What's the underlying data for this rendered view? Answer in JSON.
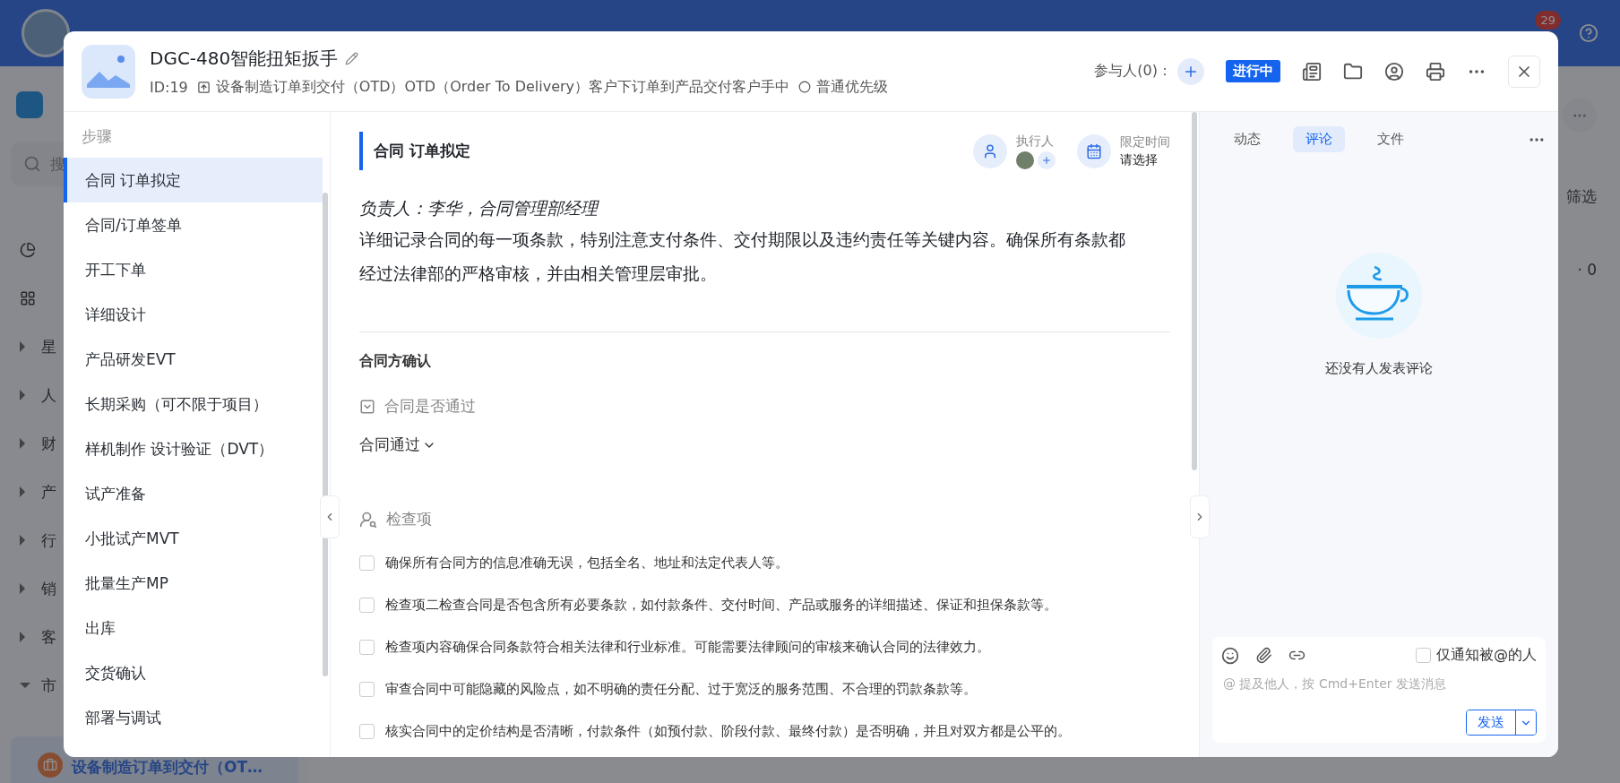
{
  "background": {
    "badge": "29",
    "search_placeholder": "搜",
    "sidebar_items": [
      {
        "label": "星",
        "expanded": false
      },
      {
        "label": "人",
        "expanded": false
      },
      {
        "label": "财",
        "expanded": false
      },
      {
        "label": "产",
        "expanded": false
      },
      {
        "label": "行",
        "expanded": false
      },
      {
        "label": "销",
        "expanded": false
      },
      {
        "label": "客",
        "expanded": false
      },
      {
        "label": "市",
        "expanded": true
      }
    ],
    "selected_item": {
      "label": "设备制造订单到交付（OT…",
      "selected": true
    },
    "filter": "筛选",
    "count": "· 0"
  },
  "modal": {
    "title": "DGC-480智能扭矩扳手",
    "id": "ID:19",
    "process": "设备制造订单到交付（OTD）OTD（Order To Delivery）客户下订单到产品交付客户手中",
    "priority": "普通优先级",
    "participants_label": "参与人(0)：",
    "status": "进行中"
  },
  "steps": {
    "heading": "步骤",
    "items": [
      {
        "label": "合同 订单拟定",
        "selected": true
      },
      {
        "label": "合同/订单签单",
        "selected": false
      },
      {
        "label": "开工下单",
        "selected": false
      },
      {
        "label": "详细设计",
        "selected": false
      },
      {
        "label": "产品研发EVT",
        "selected": false
      },
      {
        "label": "长期采购（可不限于项目）",
        "selected": false
      },
      {
        "label": "样机制作 设计验证（DVT）",
        "selected": false
      },
      {
        "label": "试产准备",
        "selected": false
      },
      {
        "label": "小批试产MVT",
        "selected": false
      },
      {
        "label": "批量生产MP",
        "selected": false
      },
      {
        "label": "出库",
        "selected": false
      },
      {
        "label": "交货确认",
        "selected": false
      },
      {
        "label": "部署与调试",
        "selected": false
      }
    ]
  },
  "step_detail": {
    "title": "合同 订单拟定",
    "executor_label": "执行人",
    "deadline_label": "限定时间",
    "deadline_value": "请选择",
    "owner": "负责人：李华，合同管理部经理",
    "description": "详细记录合同的每一项条款，特别注意支付条件、交付期限以及违约责任等关键内容。确保所有条款都经过法律部的严格审核，并由相关管理层审批。",
    "section_title": "合同方确认",
    "field_label": "合同是否通过",
    "field_value": "合同通过",
    "checklist_title": "检查项",
    "checklist": [
      {
        "text": "确保所有合同方的信息准确无误，包括全名、地址和法定代表人等。",
        "checked": false
      },
      {
        "text": "检查项二检查合同是否包含所有必要条款，如付款条件、交付时间、产品或服务的详细描述、保证和担保条款等。",
        "checked": false
      },
      {
        "text": "检查项内容确保合同条款符合相关法律和行业标准。可能需要法律顾问的审核来确认合同的法律效力。",
        "checked": false
      },
      {
        "text": "审查合同中可能隐藏的风险点，如不明确的责任分配、过于宽泛的服务范围、不合理的罚款条款等。",
        "checked": false
      },
      {
        "text": "核实合同中的定价结构是否清晰，付款条件（如预付款、阶段付款、最终付款）是否明确，并且对双方都是公平的。",
        "checked": false
      }
    ]
  },
  "comments": {
    "tabs": [
      {
        "label": "动态",
        "selected": false
      },
      {
        "label": "评论",
        "selected": true
      },
      {
        "label": "文件",
        "selected": false
      }
    ],
    "empty_text": "还没有人发表评论",
    "notify_label": "仅通知被@的人",
    "notify_checked": false,
    "input_placeholder": "@ 提及他人，按 Cmd+Enter 发送消息",
    "send": "发送"
  }
}
